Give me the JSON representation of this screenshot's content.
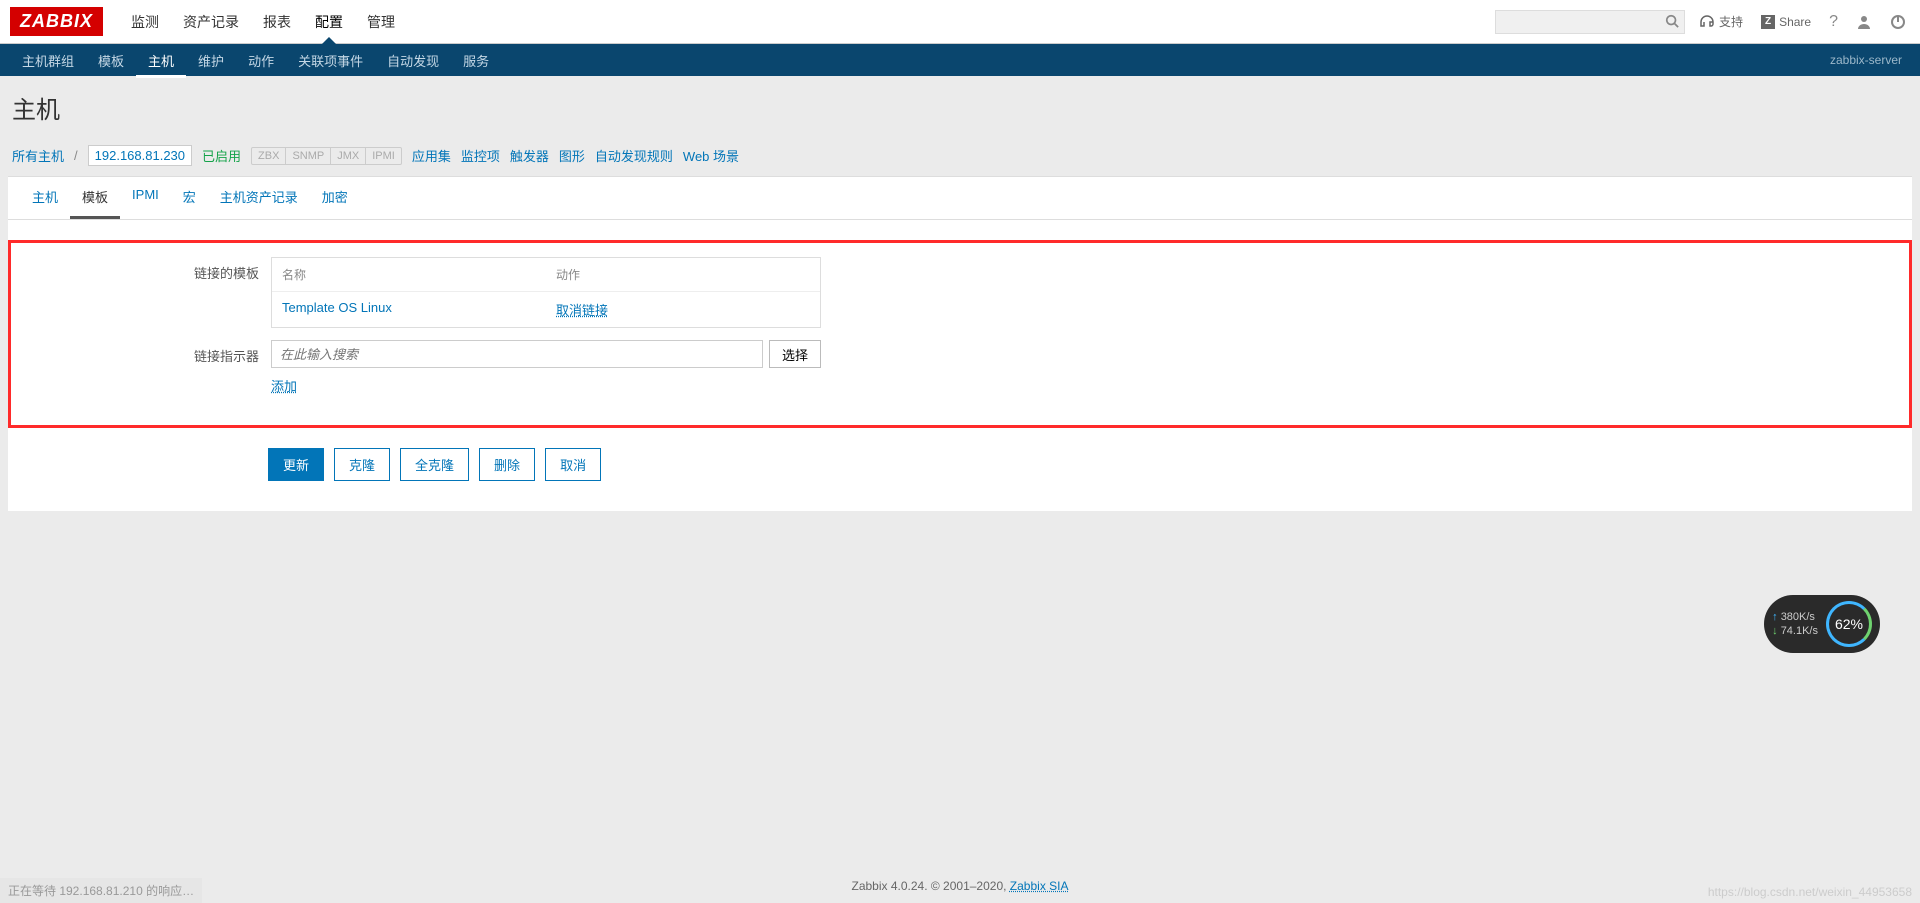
{
  "logo": "ZABBIX",
  "topnav": [
    "监测",
    "资产记录",
    "报表",
    "配置",
    "管理"
  ],
  "topnav_active": 3,
  "support": "支持",
  "share": "Share",
  "subnav": [
    "主机群组",
    "模板",
    "主机",
    "维护",
    "动作",
    "关联项事件",
    "自动发现",
    "服务"
  ],
  "subnav_active": 2,
  "server_name": "zabbix-server",
  "page_title": "主机",
  "crumbs": {
    "all_hosts": "所有主机",
    "host_ip": "192.168.81.230",
    "enabled": "已启用",
    "protocols": [
      "ZBX",
      "SNMP",
      "JMX",
      "IPMI"
    ],
    "links": [
      "应用集",
      "监控项",
      "触发器",
      "图形",
      "自动发现规则",
      "Web 场景"
    ]
  },
  "tabs": [
    "主机",
    "模板",
    "IPMI",
    "宏",
    "主机资产记录",
    "加密"
  ],
  "tabs_active": 1,
  "form": {
    "linked_label": "链接的模板",
    "name_col": "名称",
    "action_col": "动作",
    "template_name": "Template OS Linux",
    "unlink": "取消链接",
    "indicator_label": "链接指示器",
    "search_placeholder": "在此输入搜索",
    "select": "选择",
    "add": "添加"
  },
  "buttons": {
    "update": "更新",
    "clone": "克隆",
    "fullclone": "全克隆",
    "delete": "删除",
    "cancel": "取消"
  },
  "footer": {
    "text": "Zabbix 4.0.24. © 2001–2020, ",
    "link": "Zabbix SIA"
  },
  "status": "正在等待 192.168.81.210 的响应…",
  "watermark": "https://blog.csdn.net/weixin_44953658",
  "net": {
    "up": "380K/s",
    "down": "74.1K/s",
    "pct": "62%"
  }
}
